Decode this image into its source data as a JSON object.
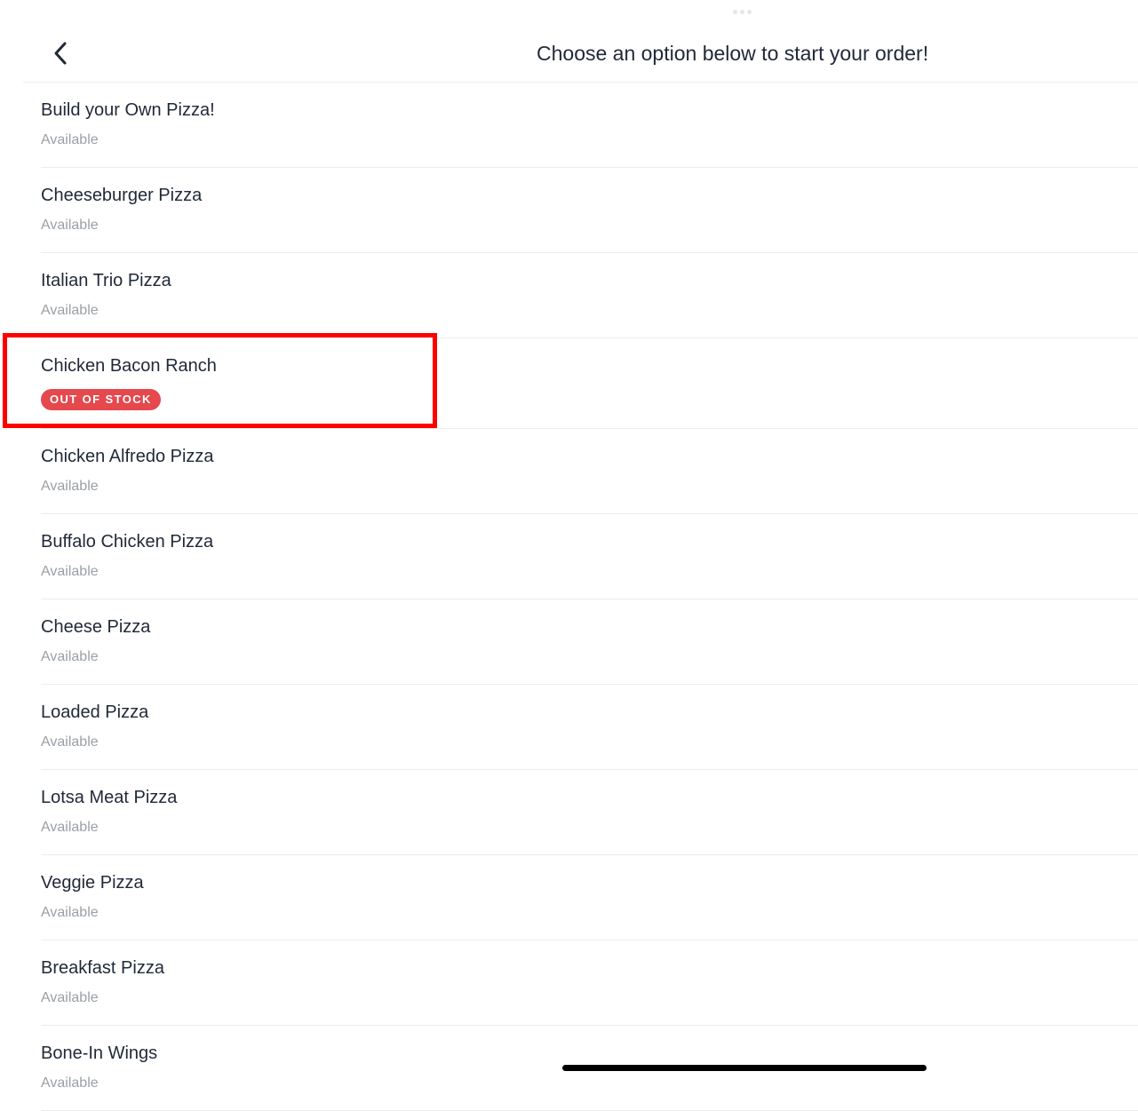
{
  "header": {
    "title": "Choose an option below to start your order!"
  },
  "colors": {
    "badge": "#e5484d",
    "highlight": "#ff0000",
    "status_text": "#9aa0a6"
  },
  "items": [
    {
      "name": "Build your Own Pizza!",
      "status": "Available"
    },
    {
      "name": "Cheeseburger Pizza",
      "status": "Available"
    },
    {
      "name": "Italian Trio Pizza",
      "status": "Available"
    },
    {
      "name": "Chicken Bacon Ranch",
      "badge": "OUT OF STOCK"
    },
    {
      "name": "Chicken Alfredo Pizza",
      "status": "Available"
    },
    {
      "name": "Buffalo Chicken Pizza",
      "status": "Available"
    },
    {
      "name": "Cheese Pizza",
      "status": "Available"
    },
    {
      "name": "Loaded Pizza",
      "status": "Available"
    },
    {
      "name": "Lotsa Meat Pizza",
      "status": "Available"
    },
    {
      "name": "Veggie Pizza",
      "status": "Available"
    },
    {
      "name": "Breakfast Pizza",
      "status": "Available"
    },
    {
      "name": "Bone-In Wings",
      "status": "Available"
    }
  ]
}
